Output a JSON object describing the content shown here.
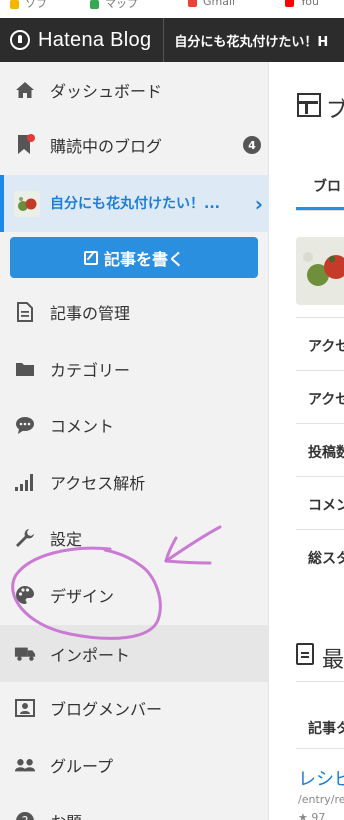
{
  "bookmarks": [
    {
      "label": "ソフ",
      "color": "#f4b400"
    },
    {
      "label": "マップ",
      "color": "#34a853"
    },
    {
      "label": "Gmail",
      "color": "#ea4335"
    },
    {
      "label": "You",
      "color": "#ff0000"
    }
  ],
  "header": {
    "logo": "Hatena Blog",
    "blog_title": "自分にも花丸付けたい！H"
  },
  "sidebar": {
    "items": [
      {
        "label": "ダッシュボード",
        "icon": "home-icon"
      },
      {
        "label": "購読中のブログ",
        "icon": "bookmark-icon",
        "badge": "4"
      },
      {
        "label": "記事の管理",
        "icon": "document-icon"
      },
      {
        "label": "カテゴリー",
        "icon": "folder-icon"
      },
      {
        "label": "コメント",
        "icon": "comment-icon"
      },
      {
        "label": "アクセス解析",
        "icon": "bar-chart-icon"
      },
      {
        "label": "設定",
        "icon": "wrench-icon"
      },
      {
        "label": "デザイン",
        "icon": "palette-icon"
      },
      {
        "label": "インポート",
        "icon": "truck-icon"
      },
      {
        "label": "ブログメンバー",
        "icon": "id-card-icon"
      },
      {
        "label": "グループ",
        "icon": "users-icon"
      },
      {
        "label": "お題",
        "icon": "question-icon"
      }
    ],
    "current_blog": {
      "label": "自分にも花丸付けたい！...",
      "thumbnail": "tomato-photo"
    },
    "write_button": "記事を書く"
  },
  "main": {
    "title": "ブ",
    "tab": "ブロ",
    "stats": [
      "アクセ",
      "アクセ",
      "投稿数",
      "コメン",
      "総スタ"
    ],
    "recent_title": "最",
    "list_header": "記事タ",
    "entry_title": "レシピ",
    "entry_path": "/entry/re",
    "entry_stars": "★ 97"
  },
  "annotation": {
    "color": "#c56fd0"
  }
}
